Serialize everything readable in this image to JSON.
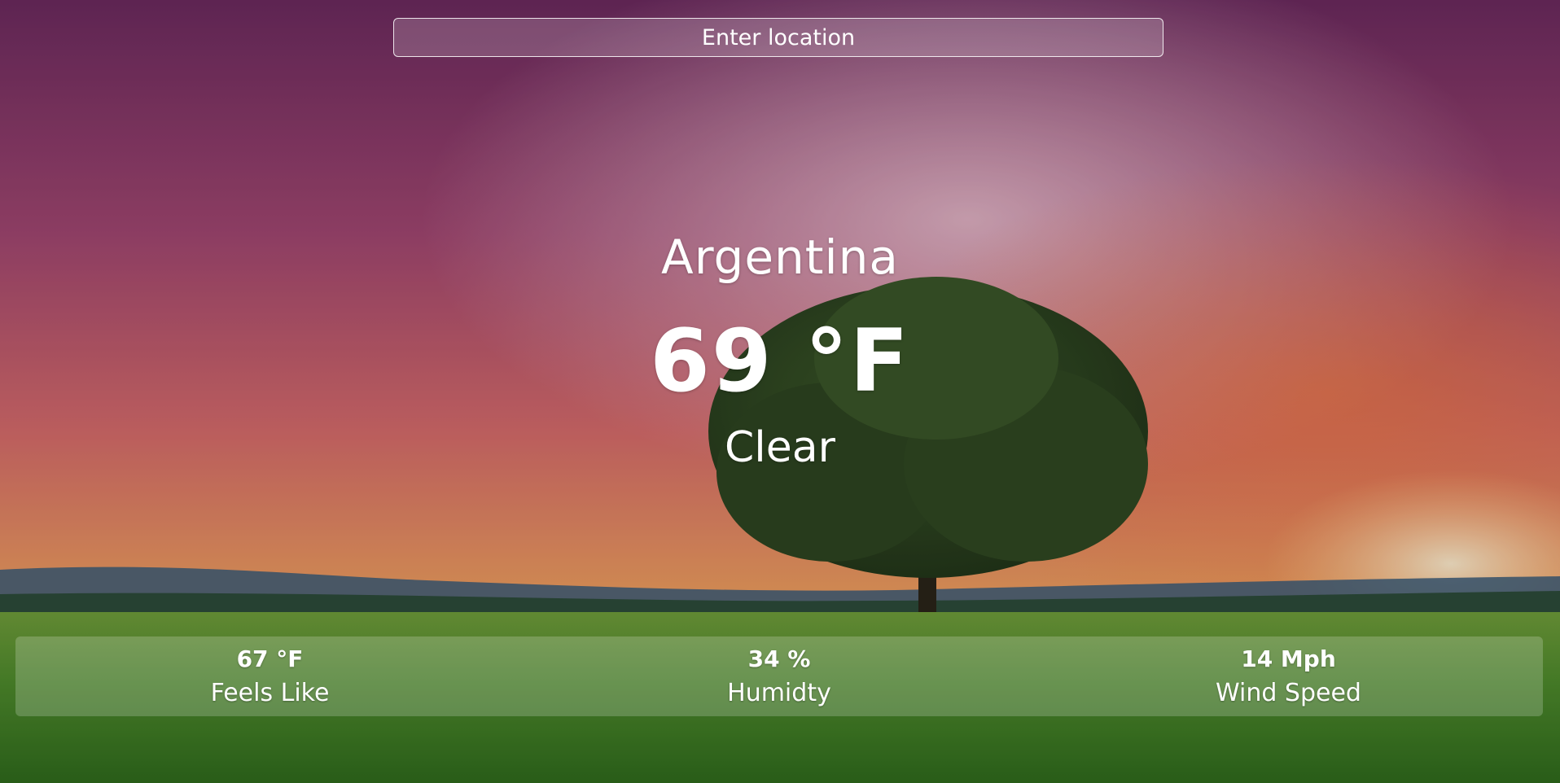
{
  "search": {
    "placeholder": "Enter location"
  },
  "weather": {
    "location": "Argentina",
    "temperature": "69 °F",
    "condition": "Clear"
  },
  "stats": [
    {
      "value": "67 °F",
      "label": "Feels Like"
    },
    {
      "value": "34 %",
      "label": "Humidty"
    },
    {
      "value": "14 Mph",
      "label": "Wind Speed"
    }
  ],
  "colors": {
    "text": "#ffffff",
    "sky_top": "#6b2a5e",
    "sky_mid": "#c4566e",
    "horizon": "#f0a05a",
    "grass": "#4e8a2c"
  }
}
